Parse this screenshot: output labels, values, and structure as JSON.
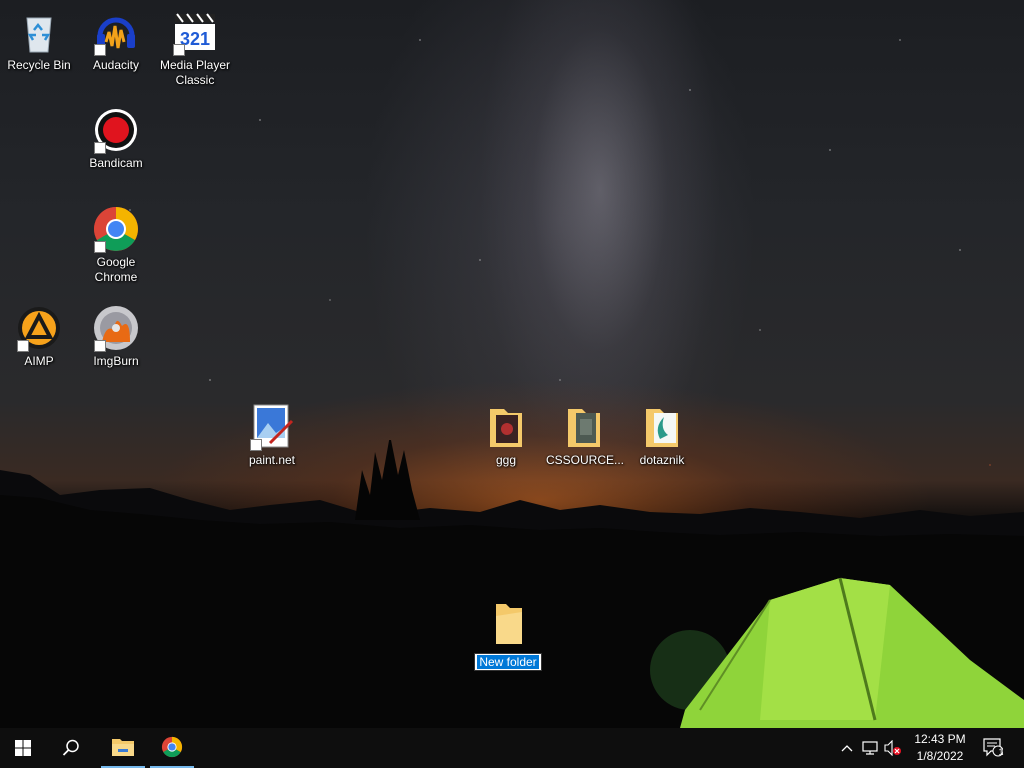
{
  "desktop": {
    "icons": [
      {
        "label": "Recycle Bin",
        "icon": "recycle-bin-icon",
        "shortcut": false
      },
      {
        "label": "Audacity",
        "icon": "audacity-icon",
        "shortcut": true
      },
      {
        "label": "Media Player Classic",
        "icon": "media-player-classic-icon",
        "shortcut": true
      },
      {
        "label": "Bandicam",
        "icon": "bandicam-icon",
        "shortcut": true
      },
      {
        "label": "Google Chrome",
        "icon": "chrome-icon",
        "shortcut": true
      },
      {
        "label": "AIMP",
        "icon": "aimp-icon",
        "shortcut": true
      },
      {
        "label": "ImgBurn",
        "icon": "imgburn-icon",
        "shortcut": true
      },
      {
        "label": "paint.net",
        "icon": "paintnet-icon",
        "shortcut": true
      },
      {
        "label": "ggg",
        "icon": "folder-icon",
        "shortcut": false
      },
      {
        "label": "CSSOURCE...",
        "icon": "folder-icon",
        "shortcut": false
      },
      {
        "label": "dotaznik",
        "icon": "folder-icon",
        "shortcut": false
      }
    ],
    "new_folder": {
      "icon": "folder-icon",
      "rename_value": "New folder"
    },
    "colors": {
      "folder": "#f4c96a",
      "selection": "#0078d7",
      "tent": "#8fd43a"
    }
  },
  "taskbar": {
    "start_icon": "windows-logo-icon",
    "search_icon": "search-icon",
    "pinned": [
      {
        "name": "File Explorer",
        "icon": "file-explorer-icon"
      },
      {
        "name": "Google Chrome",
        "icon": "chrome-icon"
      }
    ],
    "tray": {
      "chevron": "chevron-up-icon",
      "network": "network-icon",
      "volume": "volume-muted-icon"
    },
    "clock": {
      "time": "12:43 PM",
      "date": "1/8/2022"
    },
    "notifications": {
      "icon": "action-center-icon",
      "count": "1"
    }
  }
}
